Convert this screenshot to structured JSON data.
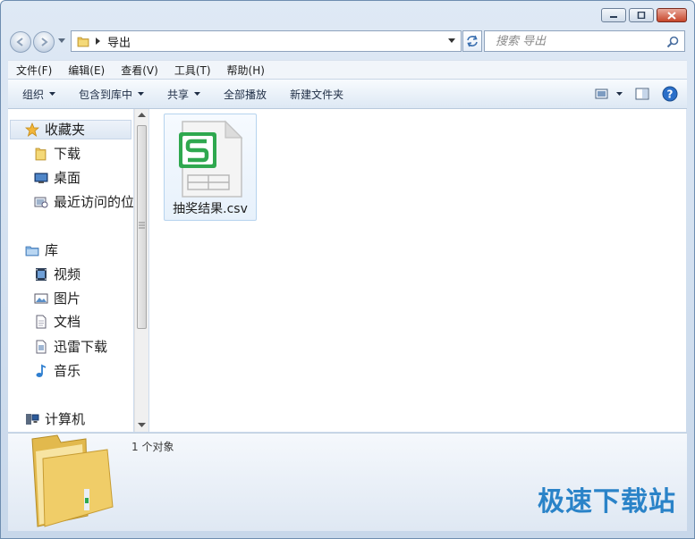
{
  "window": {
    "path": "导出"
  },
  "search": {
    "placeholder": "搜索 导出"
  },
  "menu": [
    "文件(F)",
    "编辑(E)",
    "查看(V)",
    "工具(T)",
    "帮助(H)"
  ],
  "commands": {
    "organize": "组织",
    "include": "包含到库中",
    "share": "共享",
    "play_all": "全部播放",
    "new_folder": "新建文件夹"
  },
  "sidebar": {
    "favorites": "收藏夹",
    "fav_items": [
      "下载",
      "桌面",
      "最近访问的位置"
    ],
    "libraries": "库",
    "lib_items": [
      "视频",
      "图片",
      "文档",
      "迅雷下载",
      "音乐"
    ],
    "computer": "计算机"
  },
  "files": [
    {
      "name": "抽奖结果.csv",
      "icon": "wps-spreadsheet-icon",
      "accent": "#2fa84f"
    }
  ],
  "status": {
    "count": "1 个对象"
  },
  "watermark": "极速下载站",
  "colors": {
    "accent": "#2a83c8",
    "wps_green": "#2fa84f",
    "close_red": "#c7462b"
  }
}
